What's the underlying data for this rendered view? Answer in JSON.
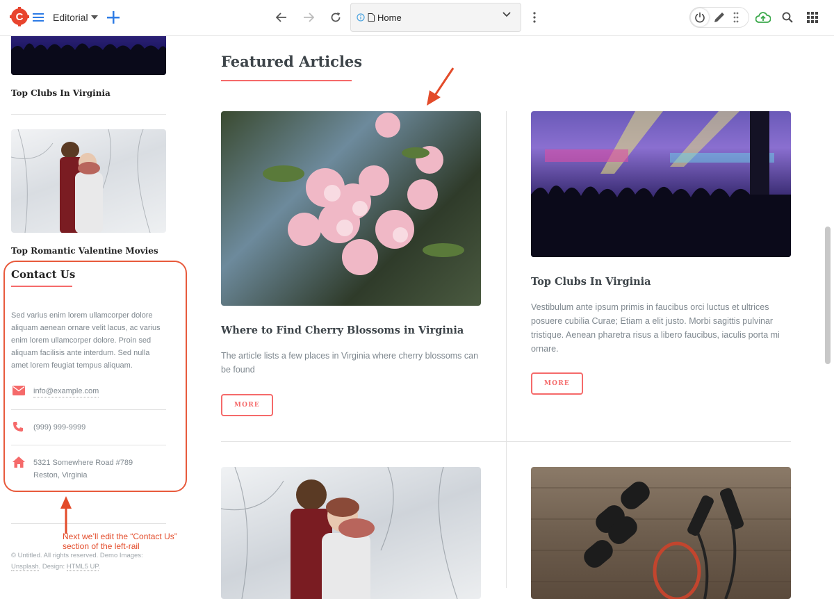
{
  "toolbar": {
    "workspace_label": "Editorial",
    "url_label": "Home"
  },
  "left_rail": {
    "articles": [
      {
        "title": "Top Clubs In Virginia"
      },
      {
        "title": "Top Romantic Valentine Movies"
      }
    ],
    "contact": {
      "heading": "Contact Us",
      "body": "Sed varius enim lorem ullamcorper dolore aliquam aenean ornare velit lacus, ac varius enim lorem ullamcorper dolore. Proin sed aliquam facilisis ante interdum. Sed nulla amet lorem feugiat tempus aliquam.",
      "email": "info@example.com",
      "phone": "(999) 999-9999",
      "address_line1": "5321 Somewhere Road #789",
      "address_line2": "Reston, Virginia"
    },
    "footer": {
      "text": "© Untitled. All rights reserved. Demo Images:",
      "link1": "Unsplash",
      "design_label": ". Design:",
      "link2": "HTML5 UP",
      "end": "."
    }
  },
  "annotation": {
    "line1": "Next we’ll edit the “Contact Us”",
    "line2": "section of the left-rail"
  },
  "main": {
    "heading": "Featured Articles",
    "articles": [
      {
        "title": "Where to Find Cherry Blossoms in Virginia",
        "body": "The article lists a few places in Virginia where cherry blossoms can be found",
        "button": "MORE"
      },
      {
        "title": "Top Clubs In Virginia",
        "body": "Vestibulum ante ipsum primis in faucibus orci luctus et ultrices posuere cubilia Curae; Etiam a elit justo. Morbi sagittis pulvinar tristique. Aenean pharetra risus a libero faucibus, iaculis porta mi ornare.",
        "button": "MORE"
      }
    ]
  },
  "colors": {
    "accent": "#f56a6a",
    "annotation": "#e85a3c",
    "brand_logo": "#e8442e",
    "toolbar_icon_blue": "#2d7be5"
  }
}
